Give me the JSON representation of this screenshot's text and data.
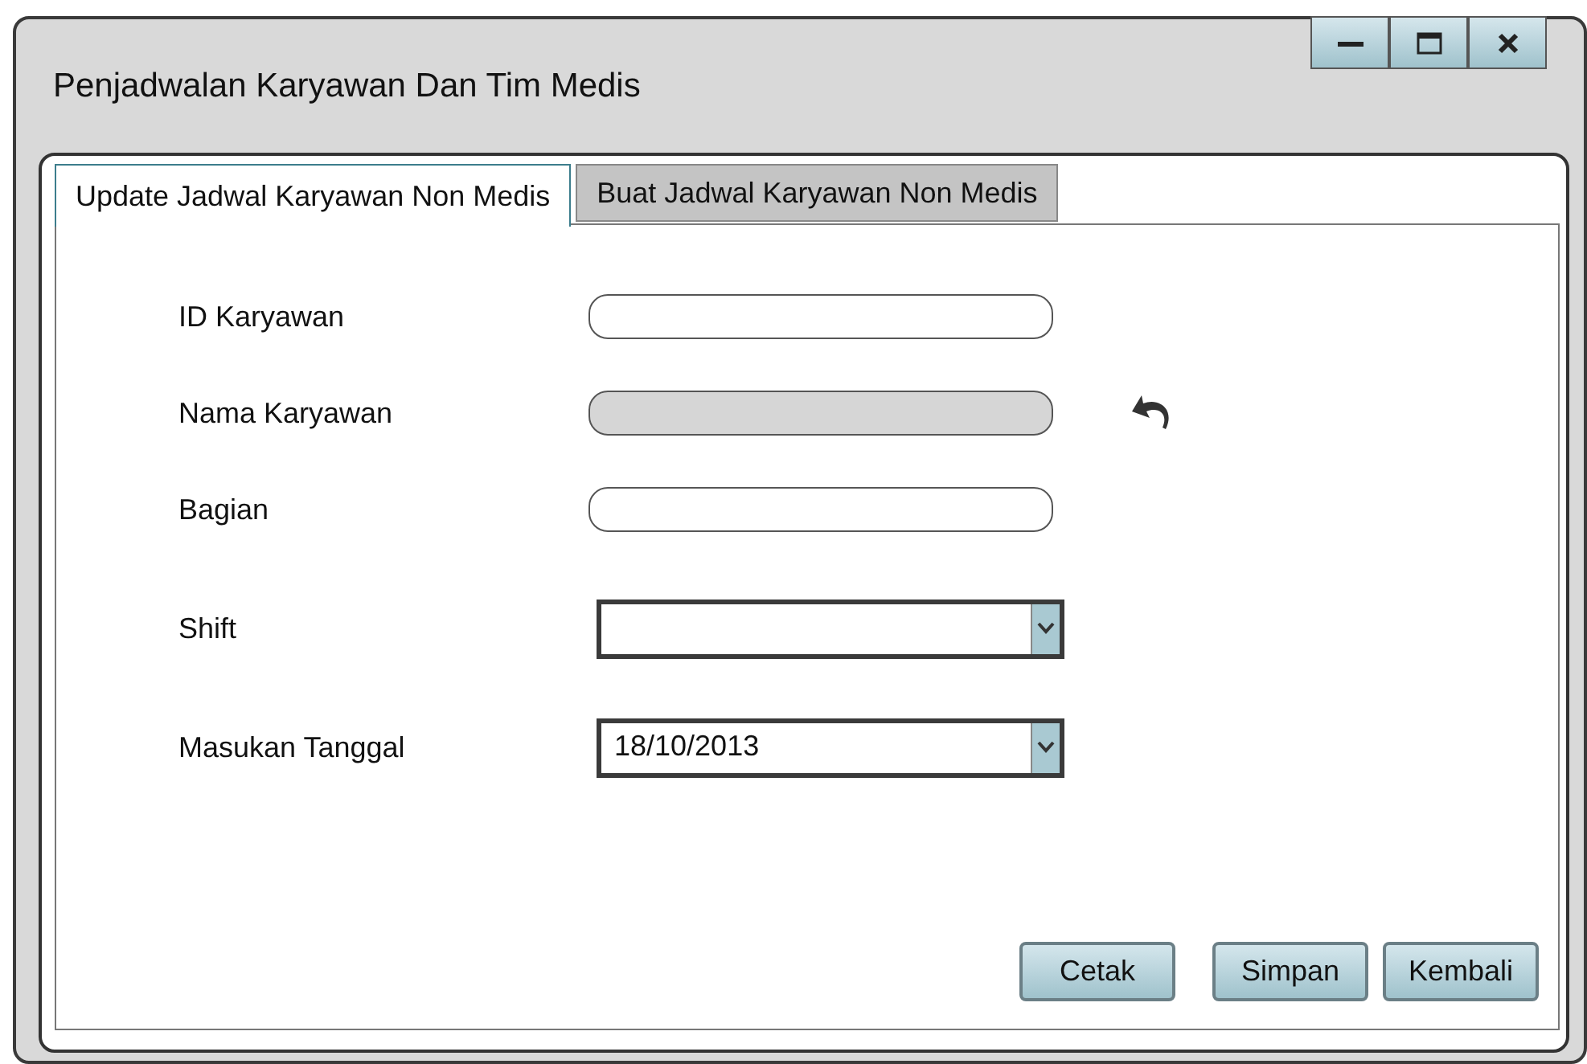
{
  "window": {
    "title": "Penjadwalan Karyawan Dan Tim Medis"
  },
  "tabs": [
    {
      "label": "Update Jadwal Karyawan Non Medis",
      "selected": true
    },
    {
      "label": "Buat Jadwal Karyawan Non Medis",
      "selected": false
    }
  ],
  "fields": [
    {
      "kind": "text",
      "label": "ID Karyawan",
      "disabled": false,
      "undo": false
    },
    {
      "kind": "text",
      "label": "Nama Karyawan",
      "disabled": true,
      "undo": true
    },
    {
      "kind": "text",
      "label": "Bagian",
      "disabled": false,
      "undo": false
    },
    {
      "kind": "select",
      "label": "Shift"
    },
    {
      "kind": "select",
      "label": "Masukan Tanggal",
      "value": "18/10/2013"
    }
  ],
  "buttons": [
    "Cetak",
    "Simpan",
    "Kembali"
  ]
}
